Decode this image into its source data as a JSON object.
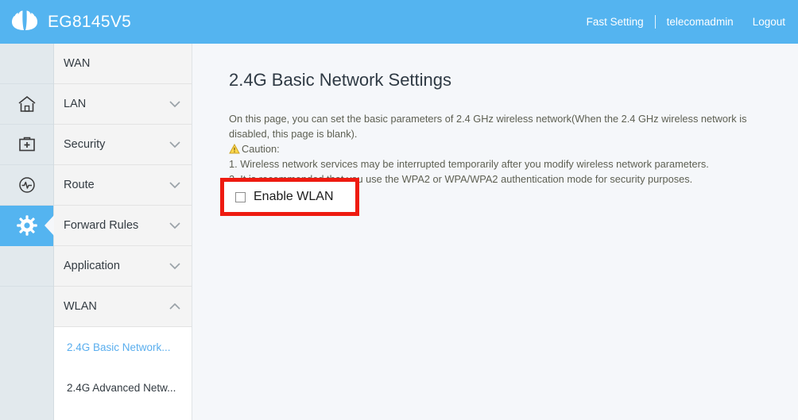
{
  "header": {
    "brand_name": "EG8145V5",
    "logo_icon": "huawei-logo",
    "fast_setting": "Fast Setting",
    "user": "telecomadmin",
    "logout": "Logout",
    "background_color": "#54b4f0"
  },
  "rail": {
    "items": [
      {
        "icon": "home-icon",
        "active": false
      },
      {
        "icon": "first-aid-kit-icon",
        "active": false
      },
      {
        "icon": "gauge-monitor-icon",
        "active": false
      },
      {
        "icon": "gear-icon",
        "active": true
      }
    ],
    "active_color": "#54b4f0",
    "background_color": "#e2e9ed"
  },
  "menu": {
    "items": [
      {
        "label": "WAN",
        "chevron": "none"
      },
      {
        "label": "LAN",
        "chevron": "chevron-down-icon"
      },
      {
        "label": "Security",
        "chevron": "chevron-down-icon"
      },
      {
        "label": "Route",
        "chevron": "chevron-down-icon"
      },
      {
        "label": "Forward Rules",
        "chevron": "chevron-down-icon"
      },
      {
        "label": "Application",
        "chevron": "chevron-down-icon"
      },
      {
        "label": "WLAN",
        "chevron": "chevron-up-icon"
      }
    ],
    "submenu": [
      {
        "label": "2.4G Basic Network...",
        "active": true
      },
      {
        "label": "2.4G Advanced Netw...",
        "active": false
      }
    ],
    "active_color": "#5aaeee"
  },
  "main": {
    "title": "2.4G Basic Network Settings",
    "description": "On this page, you can set the basic parameters of 2.4 GHz wireless network(When the 2.4 GHz wireless network is disabled, this page is blank).",
    "caution_label": "Caution:",
    "caution_icon": "warning-triangle-icon",
    "caution_items": [
      "1. Wireless network services may be interrupted temporarily after you modify wireless network parameters.",
      "2. It is recommended that you use the WPA2 or WPA/WPA2 authentication mode for security purposes."
    ],
    "enable_wlan": {
      "label": "Enable WLAN",
      "checked": false,
      "highlight_color": "#ee1b11"
    }
  }
}
